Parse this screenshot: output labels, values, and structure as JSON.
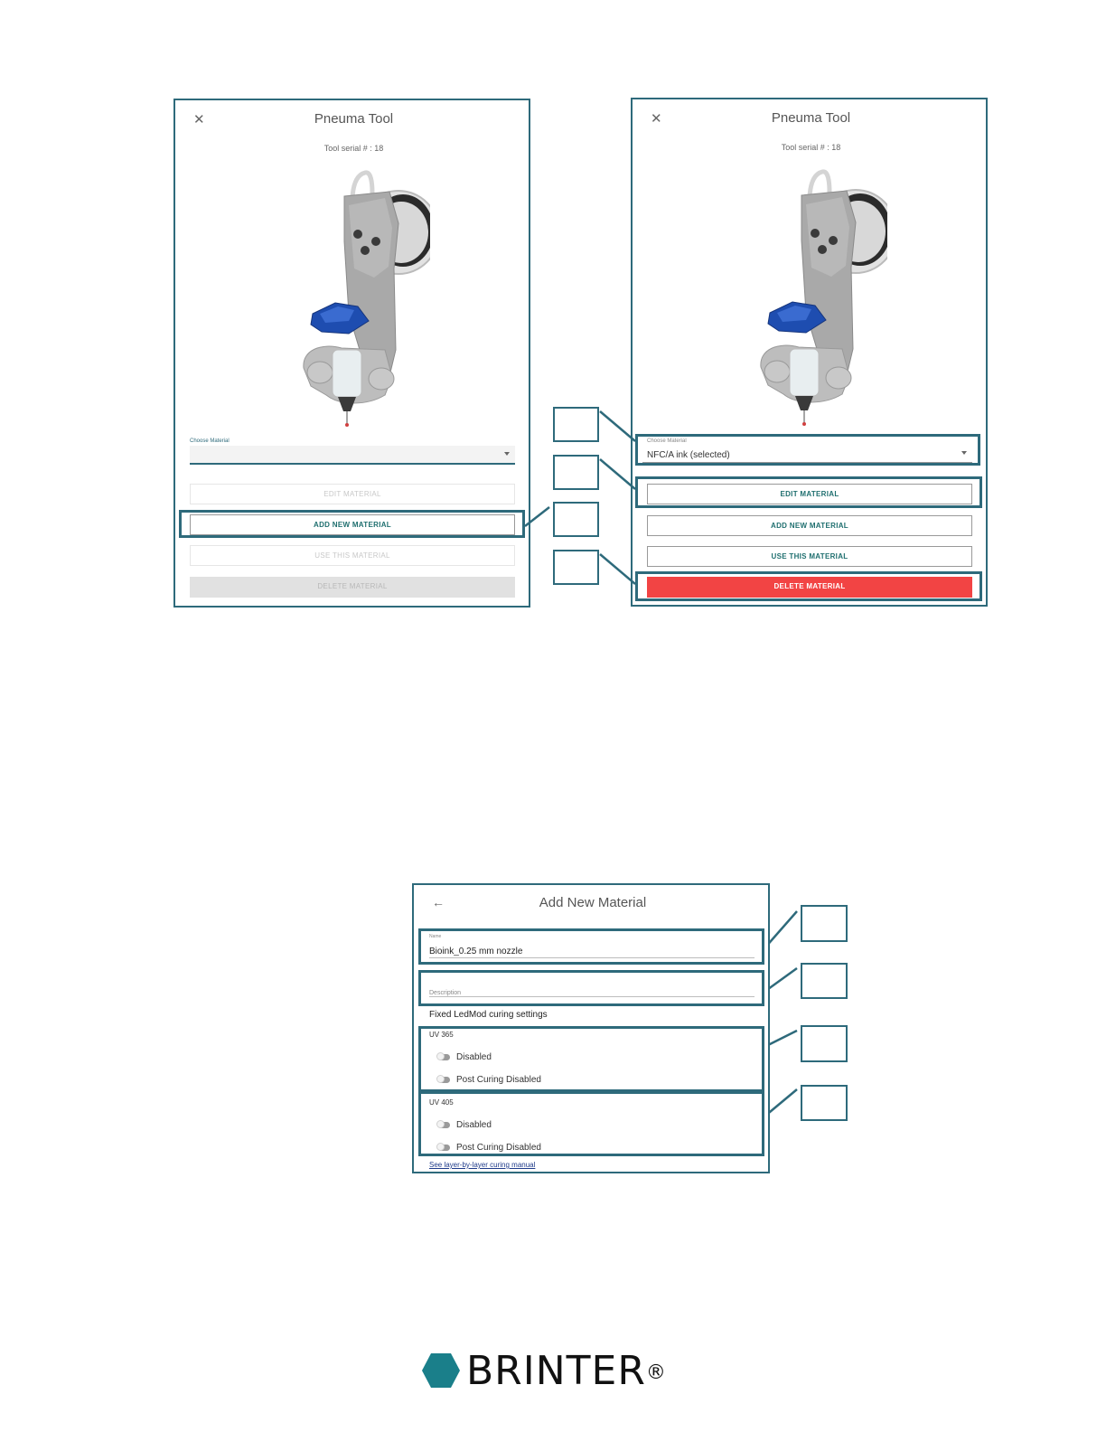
{
  "left_panel": {
    "title": "Pneuma Tool",
    "serial": "Tool serial # : 18",
    "choose_label": "Choose Material",
    "selected_value": "",
    "buttons": {
      "edit": "EDIT MATERIAL",
      "add": "ADD NEW MATERIAL",
      "use": "USE THIS MATERIAL",
      "delete": "DELETE MATERIAL"
    }
  },
  "right_panel": {
    "title": "Pneuma Tool",
    "serial": "Tool serial # : 18",
    "choose_label": "Choose Material",
    "selected_value": "NFC/A ink (selected)",
    "buttons": {
      "edit": "EDIT MATERIAL",
      "add": "ADD NEW MATERIAL",
      "use": "USE THIS MATERIAL",
      "delete": "DELETE MATERIAL"
    }
  },
  "add_material": {
    "title": "Add New Material",
    "name_label": "Name",
    "name_value": "Bioink_0.25 mm nozzle",
    "description_placeholder": "Description",
    "fixed_settings": "Fixed LedMod curing settings",
    "uv365": {
      "heading": "UV 365",
      "toggle1": "Disabled",
      "toggle2": "Post Curing Disabled"
    },
    "uv405": {
      "heading": "UV 405",
      "toggle1": "Disabled",
      "toggle2": "Post Curing Disabled"
    },
    "manual_link": "See layer-by-layer curing manual"
  },
  "brand": {
    "name": "BRINTER",
    "mark": "®",
    "color": "#1a7f8a"
  },
  "colors": {
    "accent": "#2e6a7b",
    "delete": "#f24444"
  },
  "icons": {
    "close": "close-icon",
    "back": "back-arrow-icon",
    "dropdown": "chevron-down-icon"
  }
}
